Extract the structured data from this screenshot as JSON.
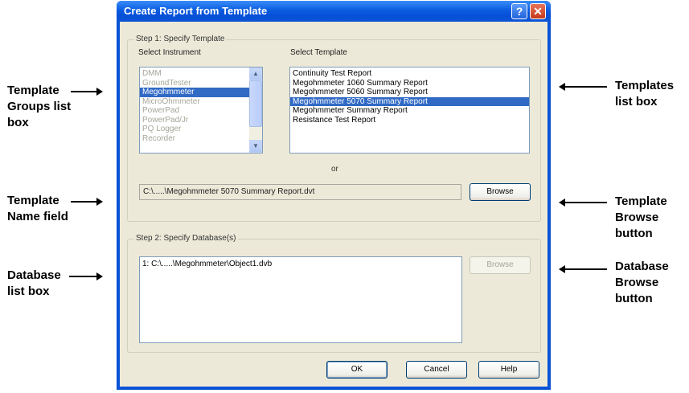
{
  "annotations": {
    "template_groups": [
      "Template",
      "Groups list",
      "box"
    ],
    "template_name": [
      "Template",
      "Name field"
    ],
    "database_list": [
      "Database",
      "list box"
    ],
    "templates_list": [
      "Templates",
      "list box"
    ],
    "template_browse": [
      "Template",
      "Browse",
      "button"
    ],
    "database_browse": [
      "Database",
      "Browse",
      "button"
    ]
  },
  "dialog": {
    "title": "Create Report from Template",
    "help_glyph": "?",
    "close_glyph": "✕",
    "step1": {
      "legend": "Step 1: Specify Template",
      "instrument_label": "Select Instrument",
      "template_label": "Select Template",
      "instruments": [
        {
          "label": "DMM",
          "state": "disabled"
        },
        {
          "label": "GroundTester",
          "state": "disabled"
        },
        {
          "label": "Megohmmeter",
          "state": "selected"
        },
        {
          "label": "MicroOhmmeter",
          "state": "disabled"
        },
        {
          "label": "PowerPad",
          "state": "disabled"
        },
        {
          "label": "PowerPad/Jr",
          "state": "disabled"
        },
        {
          "label": "PQ Logger",
          "state": "disabled"
        },
        {
          "label": "Recorder",
          "state": "disabled"
        }
      ],
      "templates": [
        {
          "label": "Continuity Test Report",
          "state": "normal"
        },
        {
          "label": "Megohmmeter 1060 Summary Report",
          "state": "normal"
        },
        {
          "label": "Megohmmeter 5060 Summary Report",
          "state": "normal"
        },
        {
          "label": "Megohmmeter 5070 Summary Report",
          "state": "selected"
        },
        {
          "label": "Megohmmeter Summary Report",
          "state": "normal"
        },
        {
          "label": "Resistance Test Report",
          "state": "normal"
        }
      ],
      "or_text": "or",
      "template_path": "C:\\.....\\Megohmmeter 5070 Summary Report.dvt",
      "browse_label": "Browse"
    },
    "step2": {
      "legend": "Step 2: Specify Database(s)",
      "databases": [
        "1: C:\\.....\\Megohmmeter\\Object1.dvb"
      ],
      "browse_label": "Browse"
    },
    "buttons": {
      "ok": "OK",
      "cancel": "Cancel",
      "help": "Help"
    }
  },
  "icons": {
    "scroll_up": "scroll-up-icon",
    "scroll_down": "scroll-down-icon"
  }
}
